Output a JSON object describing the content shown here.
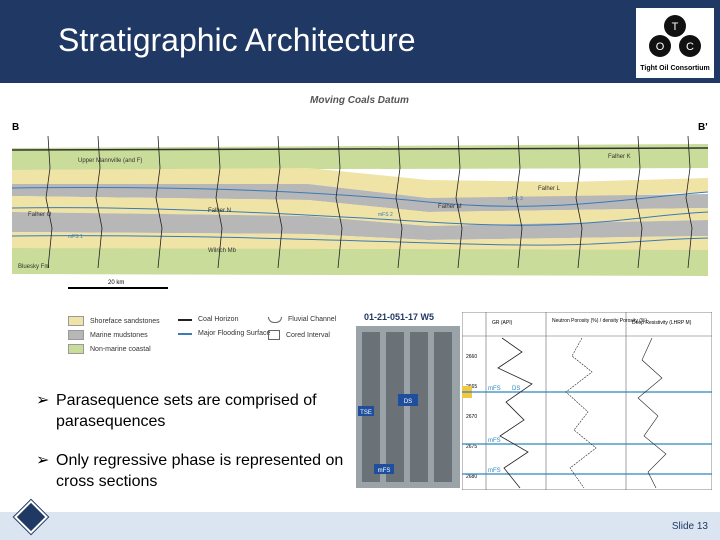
{
  "header": {
    "title": "Stratigraphic Architecture"
  },
  "logo": {
    "text": "Tight Oil Consortium",
    "letters": [
      "T",
      "O",
      "C"
    ]
  },
  "cross_section": {
    "title": "Moving Coals Datum",
    "left_label": "B",
    "right_label": "B'",
    "units": [
      "Upper Mannville (and F)",
      "Falher K",
      "Falher L",
      "Falher M",
      "Falher N",
      "Falher O",
      "Wilrich Mb",
      "Bluesky Fm"
    ],
    "markers": [
      "mFS 3",
      "mFS 2",
      "mFS 1"
    ],
    "scale_label": "20 km"
  },
  "legend": {
    "items": [
      {
        "label": "Shoreface sandstones",
        "color": "#efe3a6"
      },
      {
        "label": "Marine mudstones",
        "color": "#b7b7b7"
      },
      {
        "label": "Non-marine coastal",
        "color": "#c9dc9a"
      },
      {
        "label": "Coal Horizon"
      },
      {
        "label": "Major Flooding Surface"
      },
      {
        "label": "Fluvial Channel"
      },
      {
        "label": "Cored Interval"
      }
    ]
  },
  "core": {
    "well_label": "01-21-051-17 W5",
    "tags": [
      "mFS",
      "DS",
      "TSE",
      "mFS",
      "mFS"
    ],
    "log_headers": [
      "GR (API)",
      "Neutron Porosity (%) / density Porosity (%)",
      "Deep Resistivity (LHRP M)"
    ],
    "depths": [
      "2660",
      "2665",
      "2670",
      "2675",
      "2680"
    ]
  },
  "bullets": [
    "Parasequence sets are comprised of parasequences",
    "Only regressive phase is represented on cross sections"
  ],
  "footer": {
    "slide": "Slide 13"
  },
  "colors": {
    "header": "#1f3864",
    "footer": "#dbe5f1",
    "sand": "#efe3a6",
    "mud": "#b7b7b7",
    "coastal": "#c9dc9a"
  }
}
